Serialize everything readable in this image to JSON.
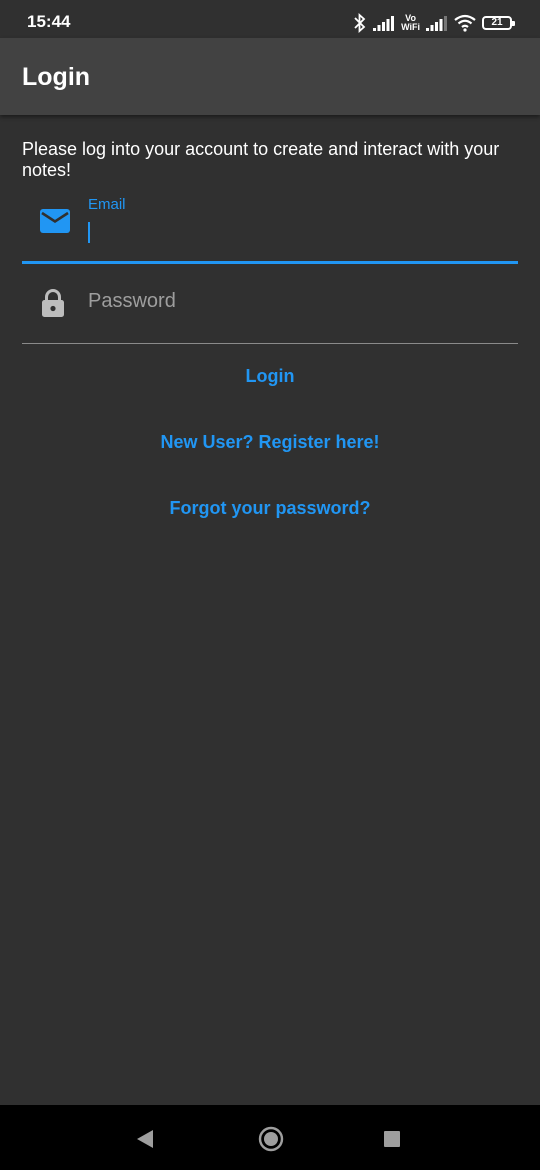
{
  "status_bar": {
    "time": "15:44",
    "volte_top": "Vo",
    "volte_bottom": "WiFi",
    "battery": "21"
  },
  "app_bar": {
    "title": "Login"
  },
  "intro": {
    "text": "Please log into your account to create and interact with your notes!"
  },
  "form": {
    "email": {
      "label": "Email",
      "value": "",
      "icon": "mail-icon"
    },
    "password": {
      "placeholder": "Password",
      "icon": "lock-icon"
    }
  },
  "actions": {
    "login": "Login",
    "register": "New User? Register here!",
    "forgot": "Forgot your password?"
  },
  "colors": {
    "accent": "#2196f3",
    "background": "#303030",
    "app_bar": "#424242"
  }
}
